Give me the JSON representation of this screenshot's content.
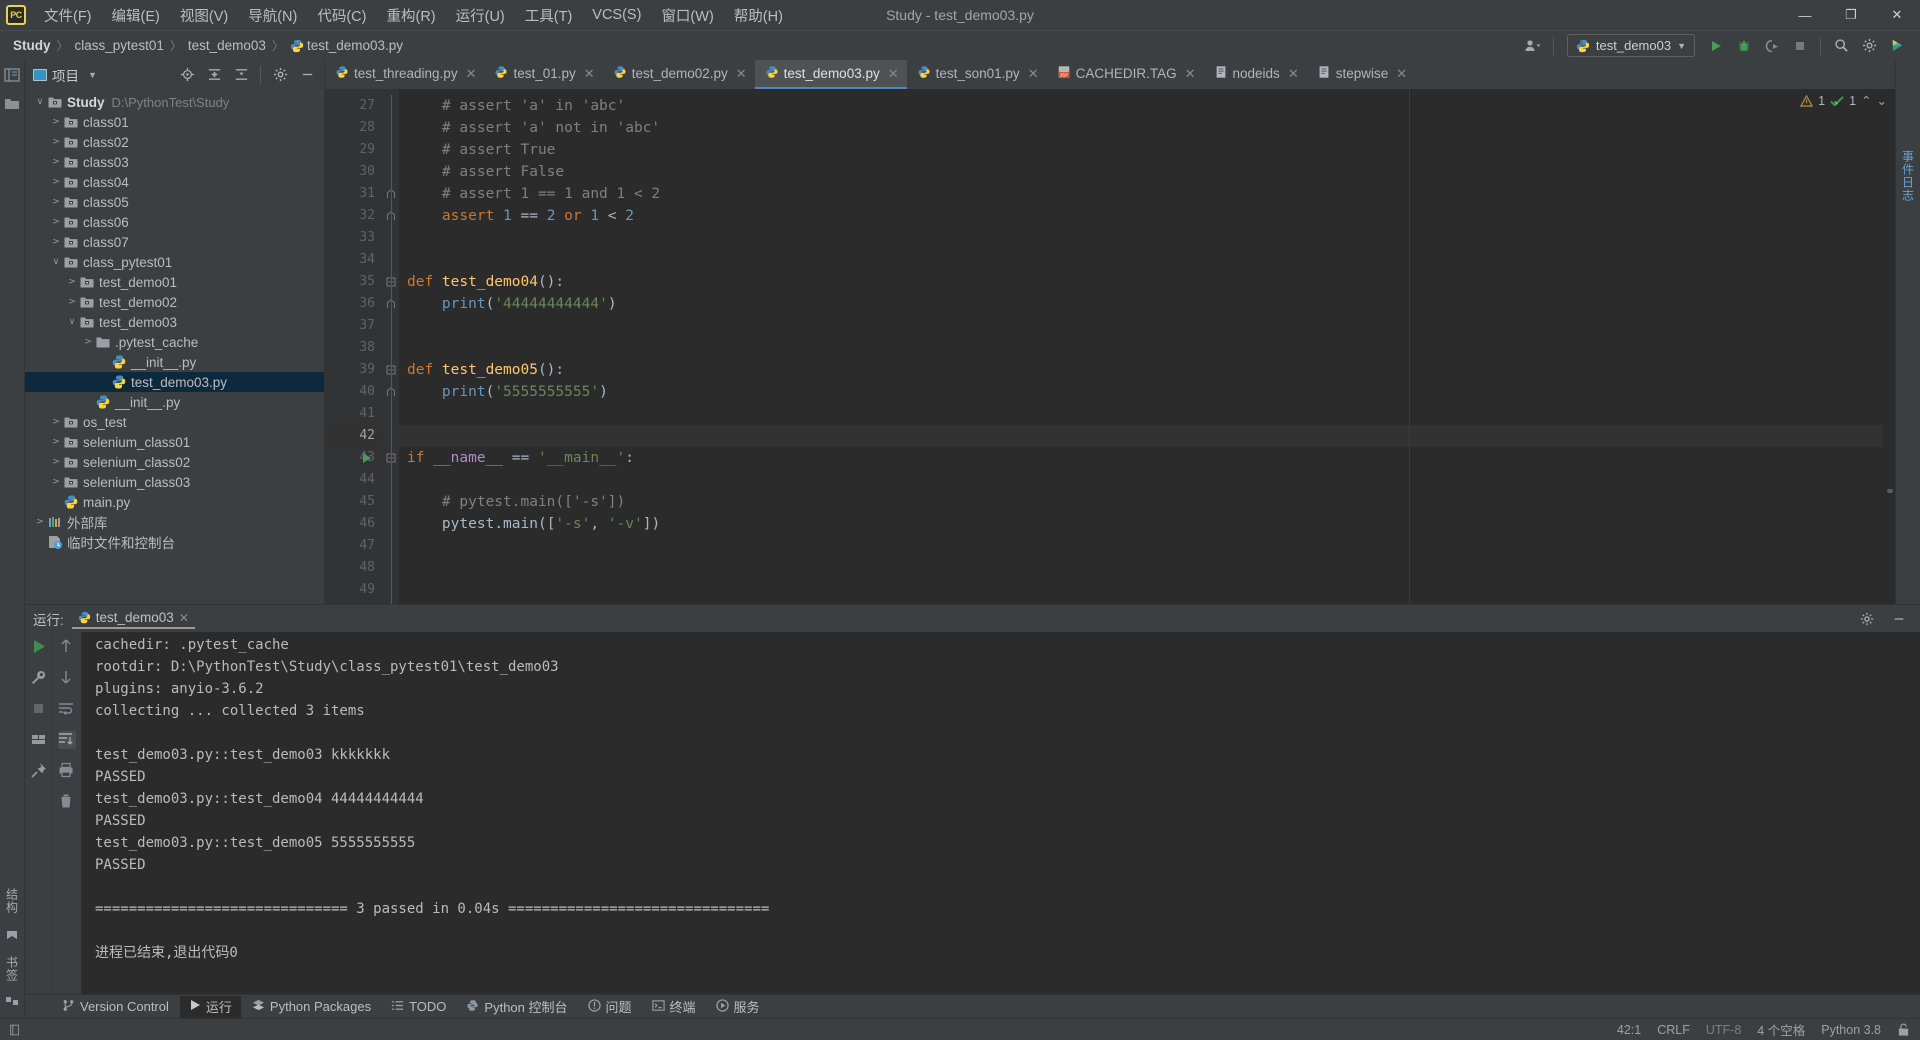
{
  "window": {
    "title": "Study - test_demo03.py",
    "logo_text": "PC",
    "minimize": "—",
    "maximize": "❐",
    "close": "✕"
  },
  "menubar": {
    "items": [
      {
        "label": "文件(F)",
        "name": "menu-file"
      },
      {
        "label": "编辑(E)",
        "name": "menu-edit"
      },
      {
        "label": "视图(V)",
        "name": "menu-view"
      },
      {
        "label": "导航(N)",
        "name": "menu-navigate"
      },
      {
        "label": "代码(C)",
        "name": "menu-code"
      },
      {
        "label": "重构(R)",
        "name": "menu-refactor"
      },
      {
        "label": "运行(U)",
        "name": "menu-run"
      },
      {
        "label": "工具(T)",
        "name": "menu-tools"
      },
      {
        "label": "VCS(S)",
        "name": "menu-vcs"
      },
      {
        "label": "窗口(W)",
        "name": "menu-window"
      },
      {
        "label": "帮助(H)",
        "name": "menu-help"
      }
    ]
  },
  "breadcrumb": {
    "items": [
      "Study",
      "class_pytest01",
      "test_demo03",
      "test_demo03.py"
    ],
    "separator": "〉"
  },
  "toolbar": {
    "run_config": "test_demo03",
    "icons": [
      "account-icon",
      "run-icon",
      "debug-icon",
      "coverage-icon",
      "stop-icon",
      "search-icon",
      "settings-icon",
      "updates-icon"
    ]
  },
  "project_panel": {
    "title": "项目",
    "header_icons": [
      "locate-icon",
      "expand-all-icon",
      "collapse-all-icon",
      "gear-icon",
      "hide-icon"
    ],
    "tree": [
      {
        "label": "Study",
        "path": "D:\\PythonTest\\Study",
        "indent": 0,
        "arrow": "down",
        "icon": "folder-module",
        "bold": true
      },
      {
        "label": "class01",
        "indent": 1,
        "arrow": "right",
        "icon": "folder"
      },
      {
        "label": "class02",
        "indent": 1,
        "arrow": "right",
        "icon": "folder"
      },
      {
        "label": "class03",
        "indent": 1,
        "arrow": "right",
        "icon": "folder"
      },
      {
        "label": "class04",
        "indent": 1,
        "arrow": "right",
        "icon": "folder"
      },
      {
        "label": "class05",
        "indent": 1,
        "arrow": "right",
        "icon": "folder"
      },
      {
        "label": "class06",
        "indent": 1,
        "arrow": "right",
        "icon": "folder"
      },
      {
        "label": "class07",
        "indent": 1,
        "arrow": "right",
        "icon": "folder"
      },
      {
        "label": "class_pytest01",
        "indent": 1,
        "arrow": "down",
        "icon": "folder"
      },
      {
        "label": "test_demo01",
        "indent": 2,
        "arrow": "right",
        "icon": "folder"
      },
      {
        "label": "test_demo02",
        "indent": 2,
        "arrow": "right",
        "icon": "folder"
      },
      {
        "label": "test_demo03",
        "indent": 2,
        "arrow": "down",
        "icon": "folder"
      },
      {
        "label": ".pytest_cache",
        "indent": 3,
        "arrow": "right",
        "icon": "folder-plain"
      },
      {
        "label": "__init__.py",
        "indent": 4,
        "arrow": "none",
        "icon": "python-file"
      },
      {
        "label": "test_demo03.py",
        "indent": 4,
        "arrow": "none",
        "icon": "python-file",
        "selected": true
      },
      {
        "label": "__init__.py",
        "indent": 3,
        "arrow": "none",
        "icon": "python-file"
      },
      {
        "label": "os_test",
        "indent": 1,
        "arrow": "right",
        "icon": "folder"
      },
      {
        "label": "selenium_class01",
        "indent": 1,
        "arrow": "right",
        "icon": "folder"
      },
      {
        "label": "selenium_class02",
        "indent": 1,
        "arrow": "right",
        "icon": "folder"
      },
      {
        "label": "selenium_class03",
        "indent": 1,
        "arrow": "right",
        "icon": "folder"
      },
      {
        "label": "main.py",
        "indent": 1,
        "arrow": "none",
        "icon": "python-file"
      },
      {
        "label": "外部库",
        "indent": 0,
        "arrow": "right",
        "icon": "library"
      },
      {
        "label": "临时文件和控制台",
        "indent": 0,
        "arrow": "none",
        "icon": "scratch"
      }
    ]
  },
  "editor": {
    "tabs": [
      {
        "label": "test_threading.py",
        "icon": "python-file",
        "active": false
      },
      {
        "label": "test_01.py",
        "icon": "python-file",
        "active": false
      },
      {
        "label": "test_demo02.py",
        "icon": "python-file",
        "active": false
      },
      {
        "label": "test_demo03.py",
        "icon": "python-file",
        "active": true
      },
      {
        "label": "test_son01.py",
        "icon": "python-file",
        "active": false
      },
      {
        "label": "CACHEDIR.TAG",
        "icon": "jsp-file",
        "active": false
      },
      {
        "label": "nodeids",
        "icon": "text-file",
        "active": false
      },
      {
        "label": "stepwise",
        "icon": "text-file",
        "active": false
      }
    ],
    "tab_close": "✕",
    "inspection": {
      "warnings": "1",
      "checks": "1",
      "up": "⌃",
      "down": "⌄",
      "vtext": "事件日志"
    },
    "first_line": 27,
    "current_line": 42,
    "lines": [
      {
        "n": 27,
        "fold": "none",
        "tokens": [
          {
            "t": "    ",
            "c": "dflt"
          },
          {
            "t": "# assert 'a' in 'abc'",
            "c": "cmt"
          }
        ]
      },
      {
        "n": 28,
        "fold": "none",
        "tokens": [
          {
            "t": "    ",
            "c": "dflt"
          },
          {
            "t": "# assert 'a' not in 'abc'",
            "c": "cmt"
          }
        ]
      },
      {
        "n": 29,
        "fold": "none",
        "tokens": [
          {
            "t": "    ",
            "c": "dflt"
          },
          {
            "t": "# assert True",
            "c": "cmt"
          }
        ]
      },
      {
        "n": 30,
        "fold": "none",
        "tokens": [
          {
            "t": "    ",
            "c": "dflt"
          },
          {
            "t": "# assert False",
            "c": "cmt"
          }
        ]
      },
      {
        "n": 31,
        "fold": "end",
        "tokens": [
          {
            "t": "    ",
            "c": "dflt"
          },
          {
            "t": "# assert 1 == 1 and 1 < 2",
            "c": "cmt"
          }
        ]
      },
      {
        "n": 32,
        "fold": "end",
        "tokens": [
          {
            "t": "    ",
            "c": "dflt"
          },
          {
            "t": "assert ",
            "c": "kw"
          },
          {
            "t": "1",
            "c": "num"
          },
          {
            "t": " == ",
            "c": "dflt"
          },
          {
            "t": "2",
            "c": "num"
          },
          {
            "t": " or ",
            "c": "kw"
          },
          {
            "t": "1",
            "c": "num"
          },
          {
            "t": " < ",
            "c": "dflt"
          },
          {
            "t": "2",
            "c": "num"
          }
        ]
      },
      {
        "n": 33,
        "fold": "none",
        "tokens": []
      },
      {
        "n": 34,
        "fold": "none",
        "tokens": []
      },
      {
        "n": 35,
        "fold": "open",
        "tokens": [
          {
            "t": "def ",
            "c": "kw"
          },
          {
            "t": "test_demo04",
            "c": "fn"
          },
          {
            "t": "():",
            "c": "dflt"
          }
        ]
      },
      {
        "n": 36,
        "fold": "end",
        "tokens": [
          {
            "t": "    ",
            "c": "dflt"
          },
          {
            "t": "print",
            "c": "num"
          },
          {
            "t": "(",
            "c": "dflt"
          },
          {
            "t": "'44444444444'",
            "c": "str"
          },
          {
            "t": ")",
            "c": "dflt"
          }
        ]
      },
      {
        "n": 37,
        "fold": "none",
        "tokens": []
      },
      {
        "n": 38,
        "fold": "none",
        "tokens": []
      },
      {
        "n": 39,
        "fold": "open",
        "tokens": [
          {
            "t": "def ",
            "c": "kw"
          },
          {
            "t": "test_demo05",
            "c": "fn"
          },
          {
            "t": "():",
            "c": "dflt"
          }
        ]
      },
      {
        "n": 40,
        "fold": "end",
        "tokens": [
          {
            "t": "    ",
            "c": "dflt"
          },
          {
            "t": "print",
            "c": "num"
          },
          {
            "t": "(",
            "c": "dflt"
          },
          {
            "t": "'5555555555'",
            "c": "str"
          },
          {
            "t": ")",
            "c": "dflt"
          }
        ]
      },
      {
        "n": 41,
        "fold": "none",
        "tokens": []
      },
      {
        "n": 42,
        "fold": "none",
        "tokens": [],
        "current": true
      },
      {
        "n": 43,
        "fold": "open",
        "run": true,
        "tokens": [
          {
            "t": "if ",
            "c": "kw"
          },
          {
            "t": "__name__",
            "c": "mgc"
          },
          {
            "t": " == ",
            "c": "dflt"
          },
          {
            "t": "'__main__'",
            "c": "str"
          },
          {
            "t": ":",
            "c": "dflt"
          }
        ]
      },
      {
        "n": 44,
        "fold": "none",
        "tokens": []
      },
      {
        "n": 45,
        "fold": "none",
        "tokens": [
          {
            "t": "    ",
            "c": "dflt"
          },
          {
            "t": "# pytest.main(['-s'])",
            "c": "cmt"
          }
        ]
      },
      {
        "n": 46,
        "fold": "none",
        "tokens": [
          {
            "t": "    ",
            "c": "dflt"
          },
          {
            "t": "pytest",
            "c": "dflt"
          },
          {
            "t": ".main([",
            "c": "dflt"
          },
          {
            "t": "'-s'",
            "c": "str"
          },
          {
            "t": ", ",
            "c": "dflt"
          },
          {
            "t": "'-v'",
            "c": "str"
          },
          {
            "t": "])",
            "c": "dflt"
          }
        ]
      },
      {
        "n": 47,
        "fold": "none",
        "tokens": []
      },
      {
        "n": 48,
        "fold": "none",
        "tokens": []
      },
      {
        "n": 49,
        "fold": "none",
        "tokens": []
      }
    ]
  },
  "run_window": {
    "label": "运行:",
    "tab_label": "test_demo03",
    "tab_close": "✕",
    "head_icons": [
      "gear-icon",
      "hide-icon"
    ],
    "rail_icons": [
      "rerun-icon",
      "wrench-icon",
      "stop-icon",
      "layout-icon",
      "pin-icon"
    ],
    "rail2_icons": [
      "up-arrow-icon",
      "down-arrow-icon",
      "soft-wrap-icon",
      "scroll-end-icon",
      "print-icon",
      "trash-icon"
    ],
    "console": [
      "cachedir: .pytest_cache",
      "rootdir: D:\\PythonTest\\Study\\class_pytest01\\test_demo03",
      "plugins: anyio-3.6.2",
      "collecting ... collected 3 items",
      "",
      "test_demo03.py::test_demo03 kkkkkkk",
      "PASSED",
      "test_demo03.py::test_demo04 44444444444",
      "PASSED",
      "test_demo03.py::test_demo05 5555555555",
      "PASSED",
      "",
      "============================== 3 passed in 0.04s ===============================",
      "",
      "进程已结束,退出代码0"
    ]
  },
  "tool_buttons": [
    {
      "label": "Version Control",
      "icon": "branch-icon",
      "active": false
    },
    {
      "label": "运行",
      "icon": "run-icon",
      "active": true
    },
    {
      "label": "Python Packages",
      "icon": "packages-icon",
      "active": false
    },
    {
      "label": "TODO",
      "icon": "todo-icon",
      "active": false
    },
    {
      "label": "Python 控制台",
      "icon": "python-icon",
      "active": false
    },
    {
      "label": "问题",
      "icon": "problems-icon",
      "active": false
    },
    {
      "label": "终端",
      "icon": "terminal-icon",
      "active": false
    },
    {
      "label": "服务",
      "icon": "services-icon",
      "active": false
    }
  ],
  "left_rail": {
    "top_icons": [
      "project-icon",
      "commit-icon"
    ],
    "bottom_labels": [
      "结构",
      "书签"
    ]
  },
  "statusbar": {
    "caret": "42:1",
    "line_sep": "CRLF",
    "encoding": "UTF-8",
    "indent": "4 个空格",
    "interpreter": "Python 3.8",
    "lock_icon": "lock-icon"
  },
  "colors": {
    "accent": "#4a88c7",
    "selection": "#0d293e",
    "panel": "#3c3f41",
    "editor_bg": "#2b2b2b",
    "green": "#499c54"
  }
}
